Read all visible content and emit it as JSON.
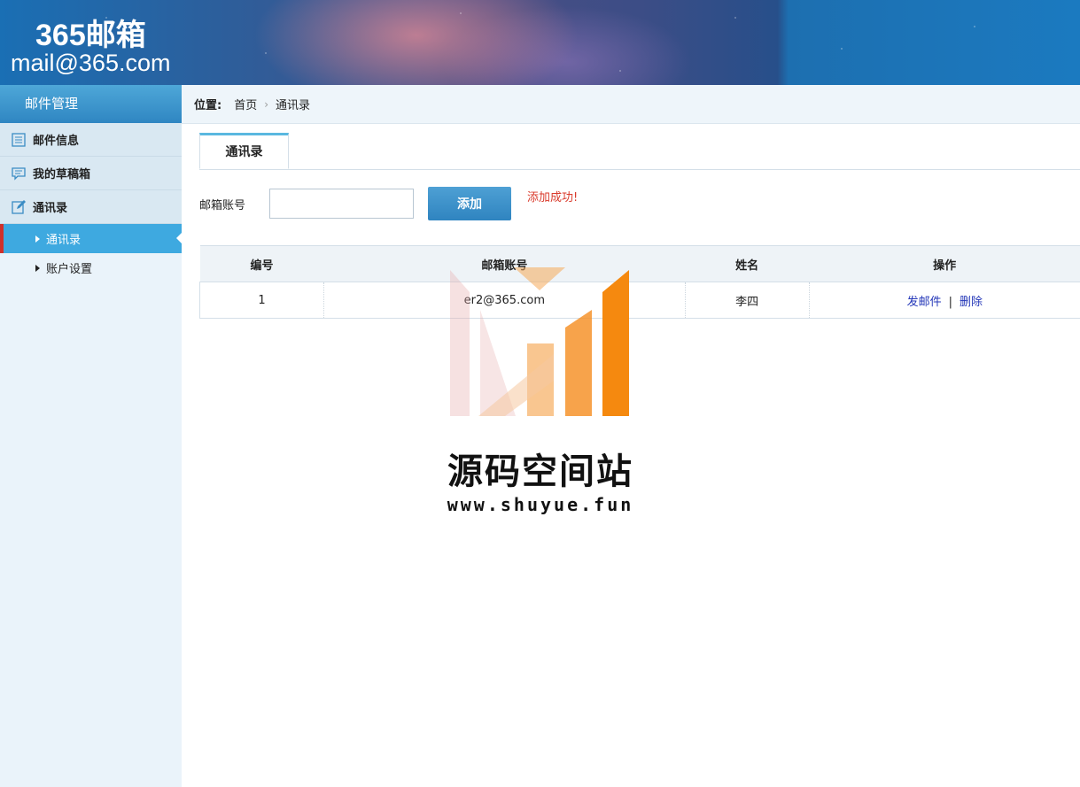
{
  "header": {
    "title": "365邮箱",
    "email": "mail@365.com"
  },
  "sidebar": {
    "section_title": "邮件管理",
    "items": [
      {
        "label": "邮件信息",
        "icon": "list-icon"
      },
      {
        "label": "我的草稿箱",
        "icon": "chat-icon"
      },
      {
        "label": "通讯录",
        "icon": "edit-icon"
      }
    ],
    "subitems": [
      {
        "label": "通讯录",
        "active": true
      },
      {
        "label": "账户设置",
        "active": false
      }
    ]
  },
  "breadcrumb": {
    "label": "位置:",
    "home": "首页",
    "current": "通讯录"
  },
  "tabs": [
    {
      "label": "通讯录",
      "active": true
    }
  ],
  "form": {
    "label": "邮箱账号",
    "input_value": "",
    "add_button": "添加",
    "message": "添加成功!"
  },
  "table": {
    "columns": [
      "编号",
      "邮箱账号",
      "姓名",
      "操作"
    ],
    "rows": [
      {
        "id": "1",
        "email": "er2@365.com",
        "name": "李四",
        "actions": [
          "发邮件",
          "删除"
        ]
      }
    ],
    "action_separator": "|"
  },
  "watermark": {
    "title": "源码空间站",
    "url": "www.shuyue.fun"
  },
  "colors": {
    "accent": "#3ea9e0",
    "message": "#d93a2b",
    "link": "#2437b8",
    "watermark_orange": "#f5890f"
  }
}
